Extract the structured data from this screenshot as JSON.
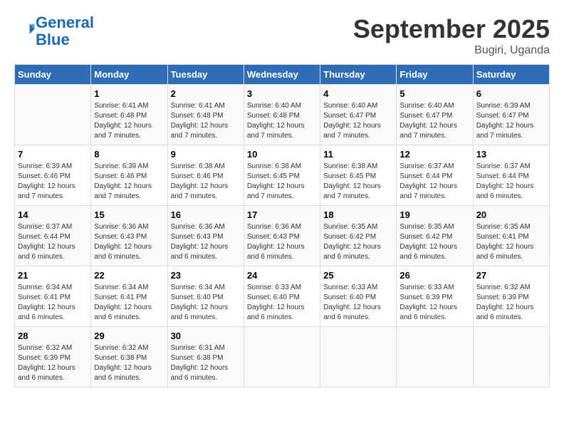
{
  "logo": {
    "line1": "General",
    "line2": "Blue"
  },
  "title": "September 2025",
  "subtitle": "Bugiri, Uganda",
  "days_header": [
    "Sunday",
    "Monday",
    "Tuesday",
    "Wednesday",
    "Thursday",
    "Friday",
    "Saturday"
  ],
  "weeks": [
    [
      {
        "day": "",
        "sunrise": "",
        "sunset": "",
        "daylight": ""
      },
      {
        "day": "1",
        "sunrise": "Sunrise: 6:41 AM",
        "sunset": "Sunset: 6:48 PM",
        "daylight": "Daylight: 12 hours and 7 minutes."
      },
      {
        "day": "2",
        "sunrise": "Sunrise: 6:41 AM",
        "sunset": "Sunset: 6:48 PM",
        "daylight": "Daylight: 12 hours and 7 minutes."
      },
      {
        "day": "3",
        "sunrise": "Sunrise: 6:40 AM",
        "sunset": "Sunset: 6:48 PM",
        "daylight": "Daylight: 12 hours and 7 minutes."
      },
      {
        "day": "4",
        "sunrise": "Sunrise: 6:40 AM",
        "sunset": "Sunset: 6:47 PM",
        "daylight": "Daylight: 12 hours and 7 minutes."
      },
      {
        "day": "5",
        "sunrise": "Sunrise: 6:40 AM",
        "sunset": "Sunset: 6:47 PM",
        "daylight": "Daylight: 12 hours and 7 minutes."
      },
      {
        "day": "6",
        "sunrise": "Sunrise: 6:39 AM",
        "sunset": "Sunset: 6:47 PM",
        "daylight": "Daylight: 12 hours and 7 minutes."
      }
    ],
    [
      {
        "day": "7",
        "sunrise": "Sunrise: 6:39 AM",
        "sunset": "Sunset: 6:46 PM",
        "daylight": "Daylight: 12 hours and 7 minutes."
      },
      {
        "day": "8",
        "sunrise": "Sunrise: 6:39 AM",
        "sunset": "Sunset: 6:46 PM",
        "daylight": "Daylight: 12 hours and 7 minutes."
      },
      {
        "day": "9",
        "sunrise": "Sunrise: 6:38 AM",
        "sunset": "Sunset: 6:46 PM",
        "daylight": "Daylight: 12 hours and 7 minutes."
      },
      {
        "day": "10",
        "sunrise": "Sunrise: 6:38 AM",
        "sunset": "Sunset: 6:45 PM",
        "daylight": "Daylight: 12 hours and 7 minutes."
      },
      {
        "day": "11",
        "sunrise": "Sunrise: 6:38 AM",
        "sunset": "Sunset: 6:45 PM",
        "daylight": "Daylight: 12 hours and 7 minutes."
      },
      {
        "day": "12",
        "sunrise": "Sunrise: 6:37 AM",
        "sunset": "Sunset: 6:44 PM",
        "daylight": "Daylight: 12 hours and 7 minutes."
      },
      {
        "day": "13",
        "sunrise": "Sunrise: 6:37 AM",
        "sunset": "Sunset: 6:44 PM",
        "daylight": "Daylight: 12 hours and 6 minutes."
      }
    ],
    [
      {
        "day": "14",
        "sunrise": "Sunrise: 6:37 AM",
        "sunset": "Sunset: 6:44 PM",
        "daylight": "Daylight: 12 hours and 6 minutes."
      },
      {
        "day": "15",
        "sunrise": "Sunrise: 6:36 AM",
        "sunset": "Sunset: 6:43 PM",
        "daylight": "Daylight: 12 hours and 6 minutes."
      },
      {
        "day": "16",
        "sunrise": "Sunrise: 6:36 AM",
        "sunset": "Sunset: 6:43 PM",
        "daylight": "Daylight: 12 hours and 6 minutes."
      },
      {
        "day": "17",
        "sunrise": "Sunrise: 6:36 AM",
        "sunset": "Sunset: 6:43 PM",
        "daylight": "Daylight: 12 hours and 6 minutes."
      },
      {
        "day": "18",
        "sunrise": "Sunrise: 6:35 AM",
        "sunset": "Sunset: 6:42 PM",
        "daylight": "Daylight: 12 hours and 6 minutes."
      },
      {
        "day": "19",
        "sunrise": "Sunrise: 6:35 AM",
        "sunset": "Sunset: 6:42 PM",
        "daylight": "Daylight: 12 hours and 6 minutes."
      },
      {
        "day": "20",
        "sunrise": "Sunrise: 6:35 AM",
        "sunset": "Sunset: 6:41 PM",
        "daylight": "Daylight: 12 hours and 6 minutes."
      }
    ],
    [
      {
        "day": "21",
        "sunrise": "Sunrise: 6:34 AM",
        "sunset": "Sunset: 6:41 PM",
        "daylight": "Daylight: 12 hours and 6 minutes."
      },
      {
        "day": "22",
        "sunrise": "Sunrise: 6:34 AM",
        "sunset": "Sunset: 6:41 PM",
        "daylight": "Daylight: 12 hours and 6 minutes."
      },
      {
        "day": "23",
        "sunrise": "Sunrise: 6:34 AM",
        "sunset": "Sunset: 6:40 PM",
        "daylight": "Daylight: 12 hours and 6 minutes."
      },
      {
        "day": "24",
        "sunrise": "Sunrise: 6:33 AM",
        "sunset": "Sunset: 6:40 PM",
        "daylight": "Daylight: 12 hours and 6 minutes."
      },
      {
        "day": "25",
        "sunrise": "Sunrise: 6:33 AM",
        "sunset": "Sunset: 6:40 PM",
        "daylight": "Daylight: 12 hours and 6 minutes."
      },
      {
        "day": "26",
        "sunrise": "Sunrise: 6:33 AM",
        "sunset": "Sunset: 6:39 PM",
        "daylight": "Daylight: 12 hours and 6 minutes."
      },
      {
        "day": "27",
        "sunrise": "Sunrise: 6:32 AM",
        "sunset": "Sunset: 6:39 PM",
        "daylight": "Daylight: 12 hours and 6 minutes."
      }
    ],
    [
      {
        "day": "28",
        "sunrise": "Sunrise: 6:32 AM",
        "sunset": "Sunset: 6:39 PM",
        "daylight": "Daylight: 12 hours and 6 minutes."
      },
      {
        "day": "29",
        "sunrise": "Sunrise: 6:32 AM",
        "sunset": "Sunset: 6:38 PM",
        "daylight": "Daylight: 12 hours and 6 minutes."
      },
      {
        "day": "30",
        "sunrise": "Sunrise: 6:31 AM",
        "sunset": "Sunset: 6:38 PM",
        "daylight": "Daylight: 12 hours and 6 minutes."
      },
      {
        "day": "",
        "sunrise": "",
        "sunset": "",
        "daylight": ""
      },
      {
        "day": "",
        "sunrise": "",
        "sunset": "",
        "daylight": ""
      },
      {
        "day": "",
        "sunrise": "",
        "sunset": "",
        "daylight": ""
      },
      {
        "day": "",
        "sunrise": "",
        "sunset": "",
        "daylight": ""
      }
    ]
  ]
}
